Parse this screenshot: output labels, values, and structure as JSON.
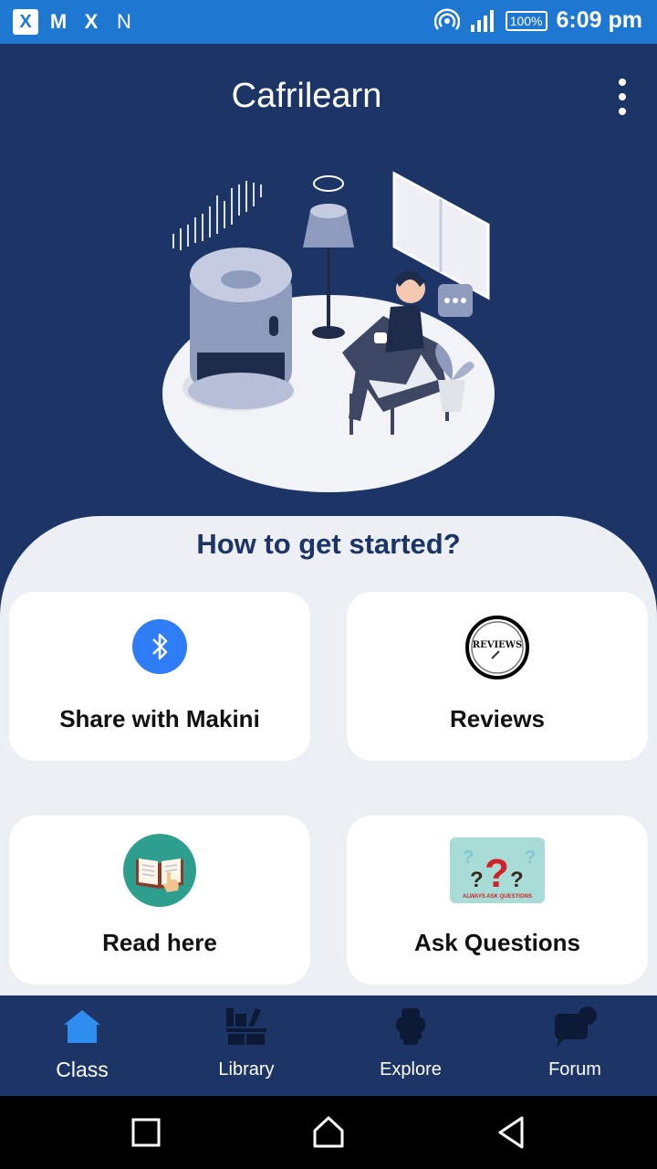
{
  "status_bar": {
    "left_icons": [
      "X",
      "M",
      "X",
      "N"
    ],
    "battery": "100%",
    "time": "6:09 pm"
  },
  "app": {
    "title": "Cafrilearn",
    "menu_icon": "more-vert-icon"
  },
  "main": {
    "heading": "How to get started?",
    "cards": [
      {
        "label": "Share with Makini",
        "icon": "bluetooth-icon"
      },
      {
        "label": "Reviews",
        "icon": "reviews-icon",
        "icon_text": "REVIEWS"
      },
      {
        "label": "Read here",
        "icon": "book-icon"
      },
      {
        "label": "Ask Questions",
        "icon": "questions-icon",
        "icon_text": "ALWAYS ASK QUESTIONS"
      }
    ]
  },
  "bottom_nav": {
    "items": [
      {
        "label": "Class",
        "icon": "home-icon",
        "active": true
      },
      {
        "label": "Library",
        "icon": "library-icon",
        "active": false
      },
      {
        "label": "Explore",
        "icon": "explore-icon",
        "active": false
      },
      {
        "label": "Forum",
        "icon": "forum-icon",
        "active": false
      }
    ]
  },
  "colors": {
    "status_bar": "#1e77d0",
    "primary": "#1c3466",
    "sheet": "#eceff3",
    "active_icon": "#2f8df0",
    "bluetooth": "#2f7df6"
  }
}
